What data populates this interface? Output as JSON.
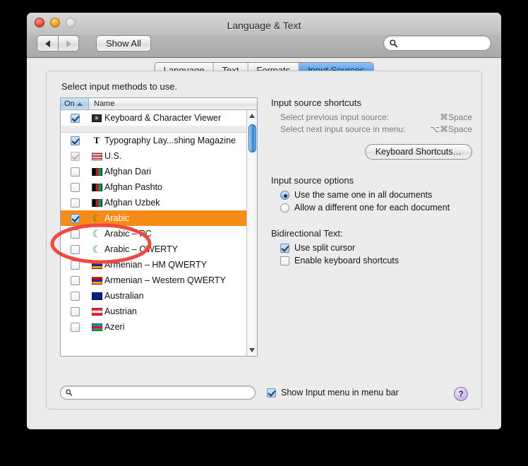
{
  "window": {
    "title": "Language & Text",
    "traffic_lights": [
      "close-button",
      "minimize-button",
      "zoom-button"
    ]
  },
  "toolbar": {
    "back_label": "back-arrow",
    "forward_label": "forward-arrow",
    "show_all_label": "Show All",
    "search_placeholder": "",
    "search_value": ""
  },
  "tabs": [
    {
      "label": "Language",
      "active": false
    },
    {
      "label": "Text",
      "active": false
    },
    {
      "label": "Formats",
      "active": false
    },
    {
      "label": "Input Sources",
      "active": true
    }
  ],
  "main": {
    "select_label": "Select input methods to use.",
    "columns": {
      "on": "On",
      "name": "Name",
      "sort": "ascending"
    },
    "rows": [
      {
        "name": "Keyboard & Character Viewer",
        "checked": true,
        "enabled": true,
        "selected": false,
        "icon": "keyboard-viewer-icon",
        "group": 0
      },
      {
        "name": "Typography Lay...shing Magazine",
        "checked": true,
        "enabled": true,
        "selected": false,
        "icon": "typography-icon",
        "group": 1
      },
      {
        "name": "U.S.",
        "checked": true,
        "enabled": false,
        "selected": false,
        "icon": "flag-us-icon",
        "group": 1
      },
      {
        "name": "Afghan Dari",
        "checked": false,
        "enabled": true,
        "selected": false,
        "icon": "flag-afghanistan-dari-icon",
        "group": 1
      },
      {
        "name": "Afghan Pashto",
        "checked": false,
        "enabled": true,
        "selected": false,
        "icon": "flag-afghanistan-pashto-icon",
        "group": 1
      },
      {
        "name": "Afghan Uzbek",
        "checked": false,
        "enabled": true,
        "selected": false,
        "icon": "flag-afghanistan-uzbek-icon",
        "group": 1
      },
      {
        "name": "Arabic",
        "checked": true,
        "enabled": true,
        "selected": true,
        "icon": "crescent-icon",
        "group": 1
      },
      {
        "name": "Arabic – PC",
        "checked": false,
        "enabled": true,
        "selected": false,
        "icon": "crescent-pc-icon",
        "group": 1
      },
      {
        "name": "Arabic – QWERTY",
        "checked": false,
        "enabled": true,
        "selected": false,
        "icon": "crescent-qwerty-icon",
        "group": 1
      },
      {
        "name": "Armenian – HM QWERTY",
        "checked": false,
        "enabled": true,
        "selected": false,
        "icon": "flag-armenia-icon",
        "group": 1
      },
      {
        "name": "Armenian – Western QWERTY",
        "checked": false,
        "enabled": true,
        "selected": false,
        "icon": "flag-armenia-icon",
        "group": 1
      },
      {
        "name": "Australian",
        "checked": false,
        "enabled": true,
        "selected": false,
        "icon": "flag-australia-icon",
        "group": 1
      },
      {
        "name": "Austrian",
        "checked": false,
        "enabled": true,
        "selected": false,
        "icon": "flag-austria-icon",
        "group": 1
      },
      {
        "name": "Azeri",
        "checked": false,
        "enabled": true,
        "selected": false,
        "icon": "flag-azerbaijan-icon",
        "group": 1
      }
    ],
    "shortcuts": {
      "title": "Input source shortcuts",
      "items": [
        {
          "label": "Select previous input source:",
          "key": "⌘Space"
        },
        {
          "label": "Select next input source in menu:",
          "key": "⌥⌘Space"
        }
      ],
      "button_label": "Keyboard Shortcuts…"
    },
    "options": {
      "title": "Input source options",
      "items": [
        {
          "label": "Use the same one in all documents",
          "selected": true
        },
        {
          "label": "Allow a different one for each document",
          "selected": false
        }
      ]
    },
    "bidi": {
      "title": "Bidirectional Text:",
      "items": [
        {
          "label": "Use split cursor",
          "checked": true
        },
        {
          "label": "Enable keyboard shortcuts",
          "checked": false
        }
      ]
    }
  },
  "bottom": {
    "search_placeholder": "",
    "search_value": "",
    "show_menu_label": "Show Input menu in menu bar",
    "show_menu_checked": true,
    "help_label": "?"
  },
  "annotation": {
    "shape": "ellipse",
    "color": "#ef4a42",
    "target": "Arabic"
  }
}
